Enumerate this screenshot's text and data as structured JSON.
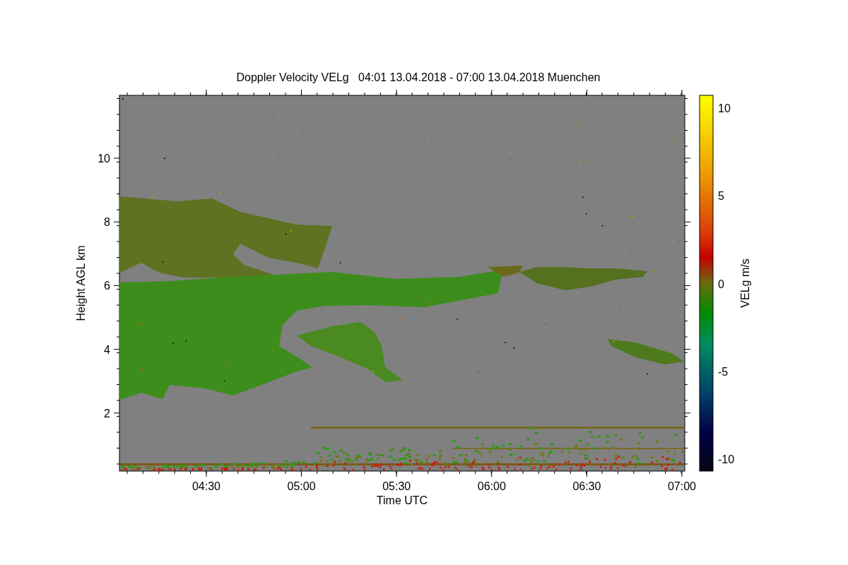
{
  "plot": {
    "title": "Doppler Velocity VELg   04:01 13.04.2018 - 07:00 13.04.2018 Muenchen",
    "xlabel": "Time UTC",
    "ylabel": "Height AGL km",
    "xtick_labels": [
      "04:30",
      "05:00",
      "05:30",
      "06:00",
      "06:30",
      "07:00"
    ],
    "ytick_labels": [
      "10",
      "8",
      "6",
      "4",
      "2"
    ]
  },
  "colorbar": {
    "label": "VELg m/s",
    "tick_labels": [
      "10",
      "5",
      "0",
      "-5",
      "-10"
    ]
  }
}
